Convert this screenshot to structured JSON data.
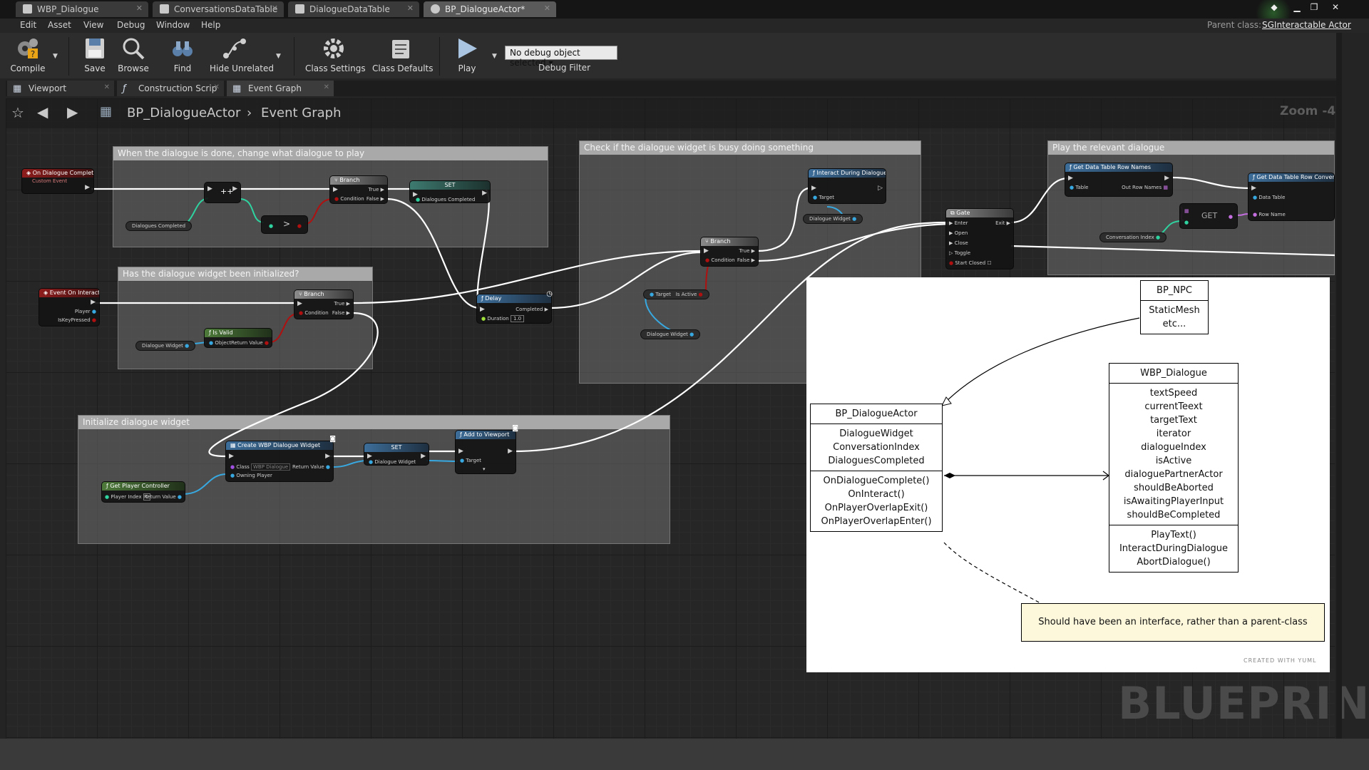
{
  "tabs": [
    {
      "label": "WBP_Dialogue",
      "active": false
    },
    {
      "label": "ConversationsDataTable",
      "active": false
    },
    {
      "label": "DialogueDataTable",
      "active": false
    },
    {
      "label": "BP_DialogueActor*",
      "active": true
    }
  ],
  "menu": [
    "Edit",
    "Asset",
    "View",
    "Debug",
    "Window",
    "Help"
  ],
  "parent_class": {
    "label": "Parent class:",
    "value": "SGInteractable Actor"
  },
  "toolbar": {
    "compile": "Compile",
    "save": "Save",
    "browse": "Browse",
    "find": "Find",
    "hide_unrelated": "Hide Unrelated",
    "class_settings": "Class Settings",
    "class_defaults": "Class Defaults",
    "play": "Play",
    "debug_object": "No debug object selected",
    "debug_filter": "Debug Filter"
  },
  "editor_tabs": [
    "Viewport",
    "Construction Scrip",
    "Event Graph"
  ],
  "breadcrumb": {
    "root": "BP_DialogueActor",
    "current": "Event Graph"
  },
  "zoom": "Zoom -4",
  "watermark": "BLUEPRINT",
  "comments": [
    "When the dialogue is done, change what dialogue to play",
    "Has the dialogue widget been initialized?",
    "Initialize dialogue widget",
    "Check if the dialogue widget is busy doing something",
    "Play the relevant dialogue"
  ],
  "nodes": {
    "on_dialogue_complete": "On Dialogue Complete",
    "custom_event": "Custom Event",
    "branch": "Branch",
    "set": "SET",
    "true": "True",
    "false": "False",
    "condition": "Condition",
    "dialogues_completed": "Dialogues Completed",
    "event_on_interact": "Event On Interact",
    "player": "Player",
    "is_key_pressed": "IsKeyPressed",
    "dialogue_widget": "Dialogue Widget",
    "is_valid": "Is Valid",
    "object": "Object",
    "return_value": "Return Value",
    "delay": "Delay",
    "completed": "Completed",
    "duration": "Duration",
    "duration_value": "1.0",
    "interact_during_dialogue": "Interact During Dialogue",
    "target": "Target",
    "is_active": "Is Active",
    "gate": "Gate",
    "enter": "Enter",
    "exit": "Exit",
    "open": "Open",
    "close": "Close",
    "toggle": "Toggle",
    "start_closed": "Start Closed",
    "get_data_table_row_names": "Get Data Table Row Names",
    "table": "Table",
    "out_row_names": "Out Row Names",
    "get": "GET",
    "conversation_index": "Conversation Index",
    "get_data_table_row_conversation": "Get Data Table Row Conversation",
    "data_table": "Data Table",
    "row_name": "Row Name",
    "create_widget": "Create WBP Dialogue Widget",
    "class": "Class",
    "owning_player": "Owning Player",
    "class_value": "WBP Dialogue",
    "add_to_viewport": "Add to Viewport",
    "get_player_controller": "Get Player Controller",
    "player_index": "Player Index",
    "player_index_value": "0"
  },
  "uml": {
    "bp_npc": {
      "name": "BP_NPC",
      "attrs": [
        "StaticMesh",
        "etc..."
      ]
    },
    "bp_dialogue_actor": {
      "name": "BP_DialogueActor",
      "attrs": [
        "DialogueWidget",
        "ConversationIndex",
        "DialoguesCompleted"
      ],
      "methods": [
        "OnDialogueComplete()",
        "OnInteract()",
        "OnPlayerOverlapExit()",
        "OnPlayerOverlapEnter()"
      ]
    },
    "wbp_dialogue": {
      "name": "WBP_Dialogue",
      "attrs": [
        "textSpeed",
        "currentTeext",
        "targetText",
        "iterator",
        "dialogueIndex",
        "isActive",
        "dialoguePartnerActor",
        "shouldBeAborted",
        "isAwaitingPlayerInput",
        "shouldBeCompleted"
      ],
      "methods": [
        "PlayText()",
        "InteractDuringDialogue",
        "AbortDialogue()"
      ]
    },
    "note": "Should have been an interface, rather than a parent-class",
    "credit": "CREATED WITH YUML"
  },
  "colors": {
    "accent_event": "#8e1c1c",
    "exec_wire": "#ffffff",
    "object_pin": "#38a8e0",
    "bool_pin": "#b01010",
    "int_pin": "#2fd3a0"
  }
}
